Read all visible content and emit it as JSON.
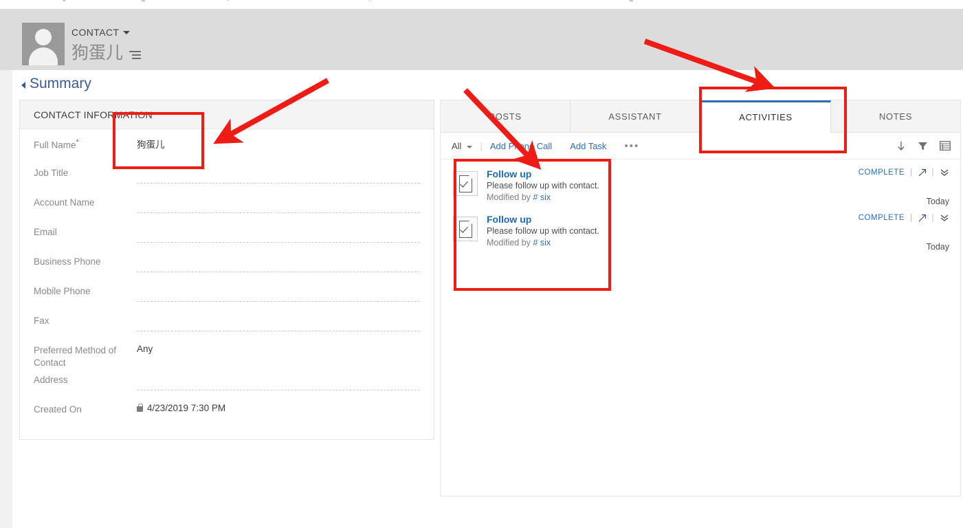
{
  "header": {
    "entity_type": "CONTACT",
    "record_title": "狗蛋儿",
    "avatar_icon": "person-placeholder-avatar",
    "dropdown_icon": "caret-down-icon",
    "title_menu_icon": "record-set-list-icon"
  },
  "summary": {
    "label": "Summary",
    "collapse_icon": "triangle-collapse-icon"
  },
  "contact_information": {
    "section_title": "CONTACT INFORMATION",
    "fields": [
      {
        "label": "Full Name",
        "required": true,
        "value": "狗蛋儿",
        "empty": false
      },
      {
        "label": "Job Title",
        "required": false,
        "value": "",
        "empty": true
      },
      {
        "label": "Account Name",
        "required": false,
        "value": "",
        "empty": true
      },
      {
        "label": "Email",
        "required": false,
        "value": "",
        "empty": true
      },
      {
        "label": "Business Phone",
        "required": false,
        "value": "",
        "empty": true
      },
      {
        "label": "Mobile Phone",
        "required": false,
        "value": "",
        "empty": true
      },
      {
        "label": "Fax",
        "required": false,
        "value": "",
        "empty": true
      },
      {
        "label": "Preferred Method of Contact",
        "required": false,
        "value": "Any",
        "empty": false
      },
      {
        "label": "Address",
        "required": false,
        "value": "",
        "empty": true
      },
      {
        "label": "Created On",
        "required": false,
        "value": "4/23/2019  7:30 PM",
        "empty": false,
        "locked": true,
        "lock_icon": "lock-icon"
      }
    ]
  },
  "right_panel": {
    "tabs": [
      {
        "label": "POSTS",
        "active": false
      },
      {
        "label": "ASSISTANT",
        "active": false
      },
      {
        "label": "ACTIVITIES",
        "active": true
      },
      {
        "label": "NOTES",
        "active": false
      }
    ],
    "toolbar": {
      "filter_label": "All",
      "filter_caret_icon": "caret-down-icon",
      "separator": "|",
      "add_phone_call": "Add Phone Call",
      "add_task": "Add Task",
      "more_label": "•••",
      "more_icon": "ellipsis-icon",
      "sort_icon": "sort-descending-arrow-icon",
      "filter_icon": "funnel-filter-icon",
      "view_icon": "grid-view-icon"
    },
    "activities": [
      {
        "icon": "task-document-check-icon",
        "title": "Follow up",
        "description": "Please follow up with contact.",
        "modified_by_label": "Modified by",
        "modified_by_user": "# six",
        "action_label": "COMPLETE",
        "open_icon": "open-record-icon",
        "expand_icon": "double-chevron-down-icon",
        "when": "Today"
      },
      {
        "icon": "task-document-check-icon",
        "title": "Follow up",
        "description": "Please follow up with contact.",
        "modified_by_label": "Modified by",
        "modified_by_user": "# six",
        "action_label": "COMPLETE",
        "open_icon": "open-record-icon",
        "expand_icon": "double-chevron-down-icon",
        "when": "Today"
      }
    ]
  },
  "annotations": {
    "color": "#ee1c15",
    "boxes": [
      {
        "name": "full-name-highlight"
      },
      {
        "name": "activities-tab-highlight"
      },
      {
        "name": "activity-items-highlight"
      }
    ],
    "arrows": [
      {
        "name": "arrow-to-full-name"
      },
      {
        "name": "arrow-to-activities-tab"
      },
      {
        "name": "arrow-to-activity-list"
      }
    ]
  }
}
